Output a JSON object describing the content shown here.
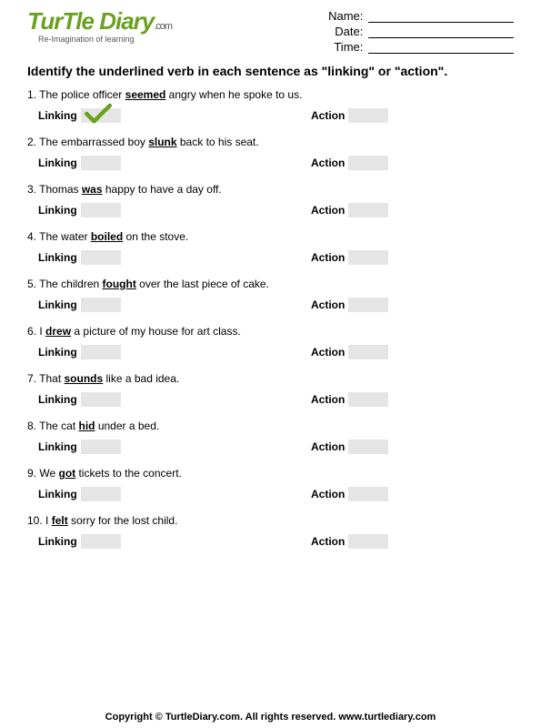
{
  "logo": {
    "main": "TurTle Diary",
    "suffix": ".com",
    "tagline": "Re-Imagination of learning"
  },
  "fields": {
    "name": "Name:",
    "date": "Date:",
    "time": "Time:"
  },
  "instructions": "Identify the underlined verb in each sentence as \"linking\" or \"action\".",
  "labels": {
    "linking": "Linking",
    "action": "Action"
  },
  "questions": [
    {
      "n": "1.",
      "pre": "The police officer ",
      "verb": "seemed",
      "post": " angry when he spoke to us.",
      "checked": "linking"
    },
    {
      "n": "2.",
      "pre": "The embarrassed boy ",
      "verb": "slunk",
      "post": " back to his seat.",
      "checked": ""
    },
    {
      "n": "3.",
      "pre": "Thomas ",
      "verb": "was",
      "post": " happy to have a day off.",
      "checked": ""
    },
    {
      "n": "4.",
      "pre": "The water ",
      "verb": "boiled",
      "post": " on the stove.",
      "checked": ""
    },
    {
      "n": "5.",
      "pre": "The children ",
      "verb": "fought",
      "post": " over the last piece of cake.",
      "checked": ""
    },
    {
      "n": "6.",
      "pre": "I ",
      "verb": "drew",
      "post": " a picture of my house for art class.",
      "checked": ""
    },
    {
      "n": "7.",
      "pre": "That ",
      "verb": "sounds",
      "post": " like a bad idea.",
      "checked": ""
    },
    {
      "n": "8.",
      "pre": "The cat ",
      "verb": "hid",
      "post": " under a bed.",
      "checked": ""
    },
    {
      "n": "9.",
      "pre": "We ",
      "verb": "got",
      "post": " tickets to the concert.",
      "checked": ""
    },
    {
      "n": "10.",
      "pre": "I ",
      "verb": "felt",
      "post": " sorry for the lost child.",
      "checked": ""
    }
  ],
  "footer": "Copyright © TurtleDiary.com. All rights reserved. www.turtlediary.com"
}
